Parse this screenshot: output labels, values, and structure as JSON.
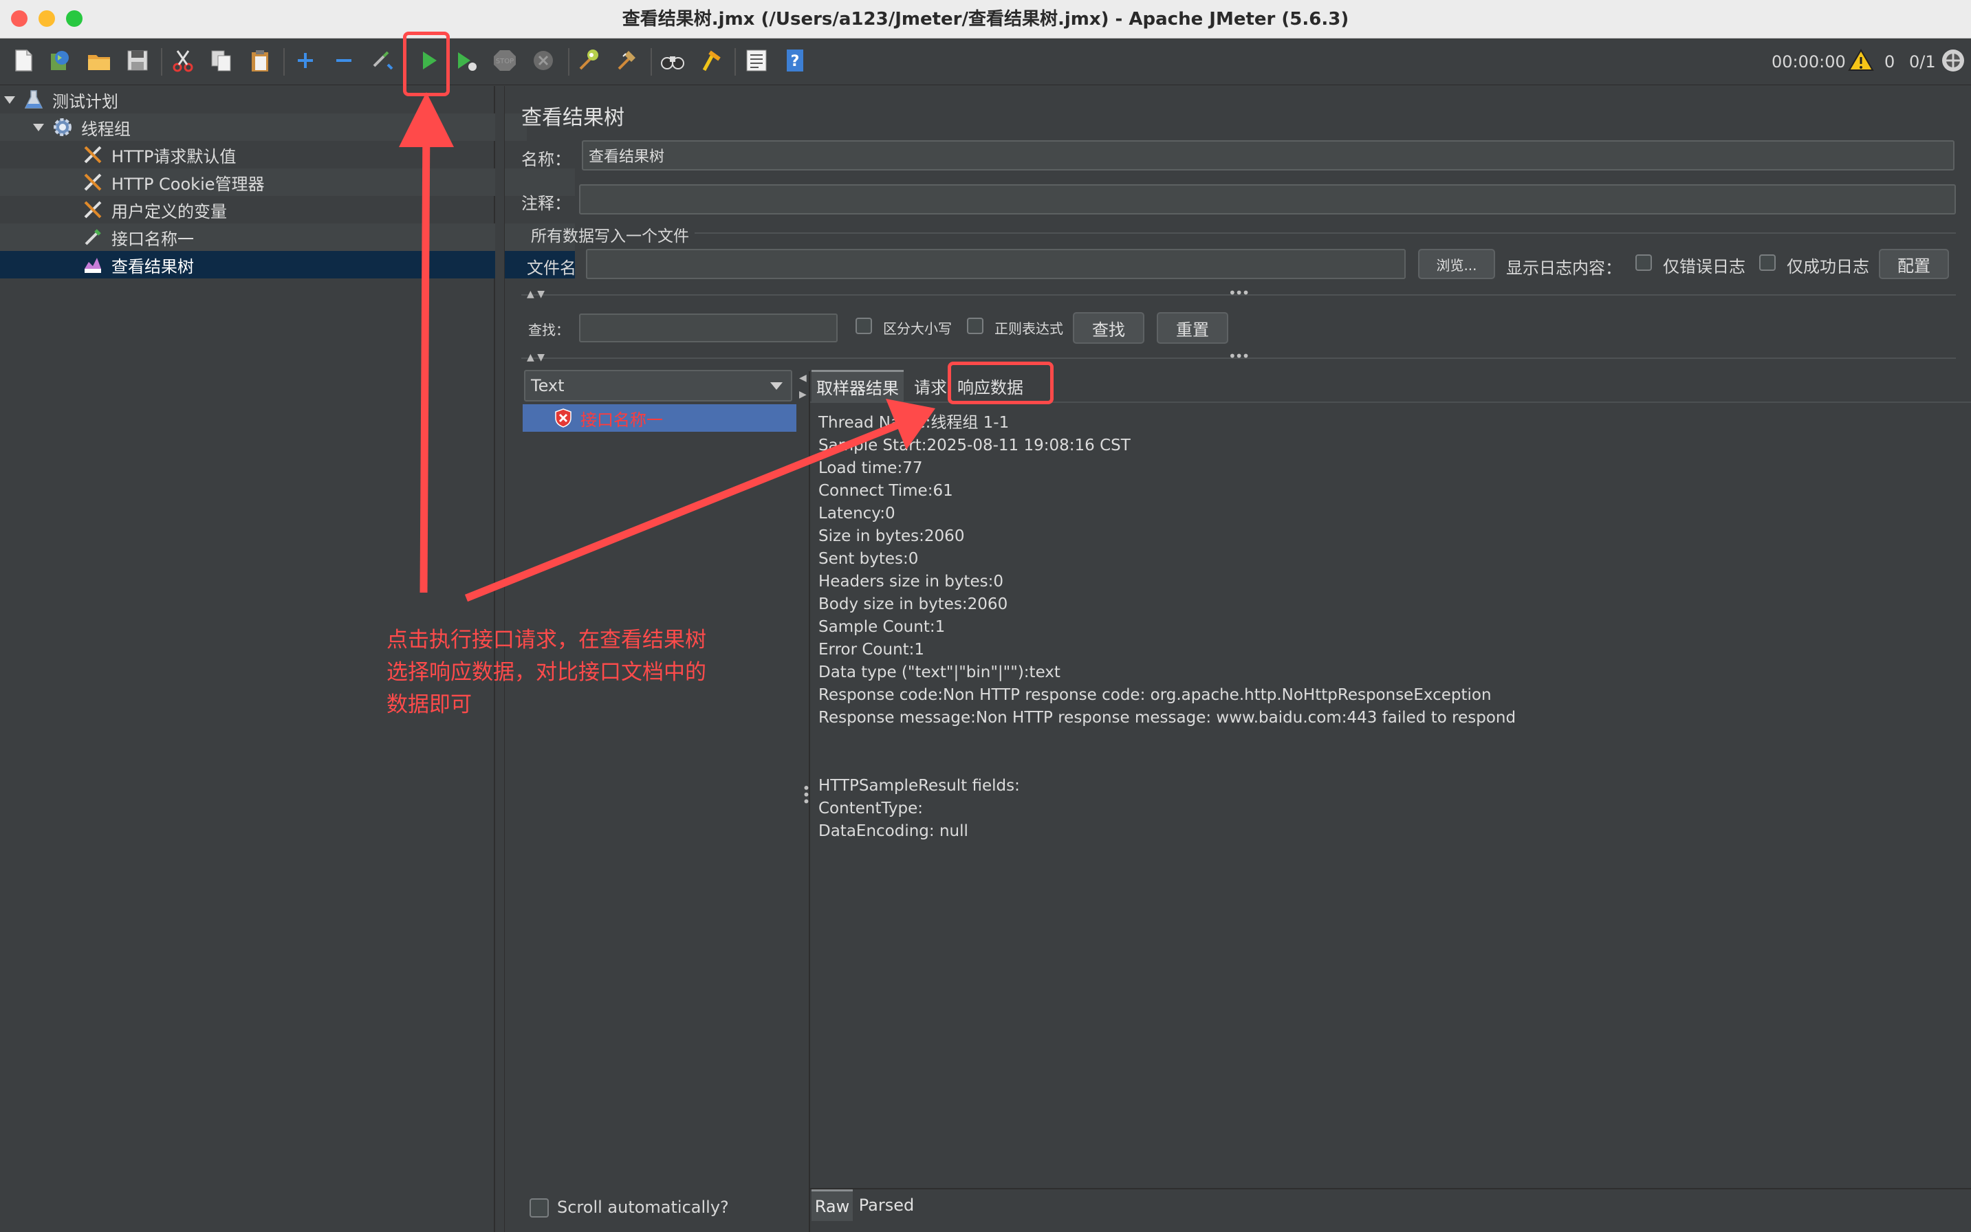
{
  "window": {
    "title": "查看结果树.jmx (/Users/a123/Jmeter/查看结果树.jmx) - Apache JMeter (5.6.3)"
  },
  "toolbar": {
    "icons": [
      "new-icon",
      "templates-icon",
      "open-icon",
      "save-icon",
      "cut-icon",
      "copy-icon",
      "paste-icon",
      "expand-icon",
      "collapse-icon",
      "toggle-icon",
      "start-icon",
      "start-no-timers-icon",
      "stop-icon",
      "shutdown-icon",
      "clear-icon",
      "clear-all-icon",
      "search-icon",
      "reset-search-icon",
      "function-helper-icon",
      "help-icon"
    ],
    "timer": "00:00:00",
    "warning_count": "0",
    "threads": "0/1"
  },
  "tree": {
    "items": [
      {
        "label": "测试计划",
        "icon": "flask-icon"
      },
      {
        "label": "线程组",
        "icon": "gear-icon"
      },
      {
        "label": "HTTP请求默认值",
        "icon": "wrench-icon"
      },
      {
        "label": "HTTP Cookie管理器",
        "icon": "wrench-icon"
      },
      {
        "label": "用户定义的变量",
        "icon": "wrench-icon"
      },
      {
        "label": "接口名称一",
        "icon": "pipette-icon"
      },
      {
        "label": "查看结果树",
        "icon": "chart-icon"
      }
    ]
  },
  "panel": {
    "heading": "查看结果树",
    "name_label": "名称：",
    "name_value": "查看结果树",
    "comment_label": "注释：",
    "comment_value": "",
    "file_section": "所有数据写入一个文件",
    "filename_label": "文件名",
    "filename_value": "",
    "browse_label": "浏览...",
    "log_label": "显示日志内容：",
    "errors_only": "仅错误日志",
    "success_only": "仅成功日志",
    "configure": "配置",
    "search_label": "查找：",
    "search_value": "",
    "case_sensitive": "区分大小写",
    "regex": "正则表达式",
    "find_button": "查找",
    "reset_button": "重置",
    "renderer": "Text",
    "sample_item": "接口名称一",
    "tabs": [
      "取样器结果",
      "请求",
      "响应数据"
    ],
    "scroll_auto": "Scroll automatically?",
    "bottom_tabs": [
      "Raw",
      "Parsed"
    ]
  },
  "result_lines": [
    "Thread Name:线程组 1-1",
    "Sample Start:2025-08-11 19:08:16 CST",
    "Load time:77",
    "Connect Time:61",
    "Latency:0",
    "Size in bytes:2060",
    "Sent bytes:0",
    "Headers size in bytes:0",
    "Body size in bytes:2060",
    "Sample Count:1",
    "Error Count:1",
    "Data type (\"text\"|\"bin\"|\"\"):text",
    "Response code:Non HTTP response code: org.apache.http.NoHttpResponseException",
    "Response message:Non HTTP response message: www.baidu.com:443 failed to respond",
    "",
    "",
    "HTTPSampleResult fields:",
    "ContentType:",
    "DataEncoding: null"
  ],
  "annotation": {
    "line1": "点击执行接口请求，在查看结果树",
    "line2": "选择响应数据，对比接口文档中的",
    "line3": "数据即可"
  },
  "colors": {
    "background": "#3c3f41",
    "selection": "#0d2a46",
    "sample_selection": "#4a6fb0",
    "error_text": "#ff3c3c",
    "annotation": "#ff4a4a"
  }
}
